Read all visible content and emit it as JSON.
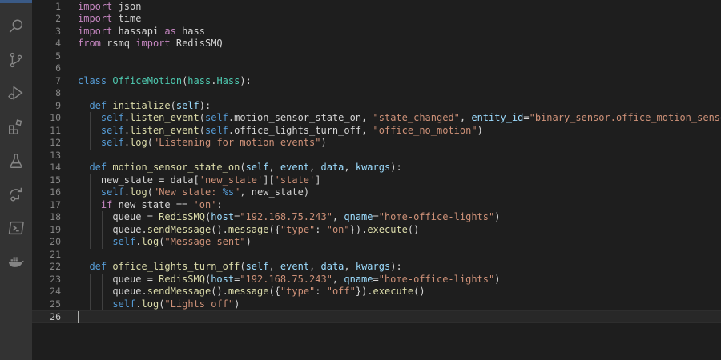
{
  "activity_bar": {
    "items": [
      {
        "name": "explorer-icon"
      },
      {
        "name": "search-icon"
      },
      {
        "name": "source-control-icon"
      },
      {
        "name": "run-debug-icon"
      },
      {
        "name": "extensions-icon"
      },
      {
        "name": "testing-icon"
      },
      {
        "name": "remote-explorer-icon"
      },
      {
        "name": "terminal-icon"
      },
      {
        "name": "docker-icon"
      }
    ]
  },
  "editor": {
    "language": "python",
    "cursor_line": 26,
    "lines": [
      {
        "n": "1",
        "indent": 0,
        "tokens": [
          [
            "import",
            "ctl"
          ],
          [
            " json",
            "pl"
          ]
        ]
      },
      {
        "n": "2",
        "indent": 0,
        "tokens": [
          [
            "import",
            "ctl"
          ],
          [
            " time",
            "pl"
          ]
        ]
      },
      {
        "n": "3",
        "indent": 0,
        "tokens": [
          [
            "import",
            "ctl"
          ],
          [
            " hassapi ",
            "pl"
          ],
          [
            "as",
            "ctl"
          ],
          [
            " hass",
            "pl"
          ]
        ]
      },
      {
        "n": "4",
        "indent": 0,
        "tokens": [
          [
            "from",
            "ctl"
          ],
          [
            " rsmq ",
            "pl"
          ],
          [
            "import",
            "ctl"
          ],
          [
            " RedisSMQ",
            "pl"
          ]
        ]
      },
      {
        "n": "5",
        "indent": 0,
        "tokens": []
      },
      {
        "n": "6",
        "indent": 0,
        "tokens": []
      },
      {
        "n": "7",
        "indent": 0,
        "tokens": [
          [
            "class",
            "kw"
          ],
          [
            " ",
            "pl"
          ],
          [
            "OfficeMotion",
            "cls"
          ],
          [
            "(",
            "pl"
          ],
          [
            "hass",
            "cls"
          ],
          [
            ".",
            "pl"
          ],
          [
            "Hass",
            "cls"
          ],
          [
            "):",
            "pl"
          ]
        ]
      },
      {
        "n": "8",
        "indent": 0,
        "tokens": []
      },
      {
        "n": "9",
        "indent": 1,
        "tokens": [
          [
            "  ",
            "pl"
          ],
          [
            "def",
            "kw"
          ],
          [
            " ",
            "pl"
          ],
          [
            "initialize",
            "fn"
          ],
          [
            "(",
            "pl"
          ],
          [
            "self",
            "prm"
          ],
          [
            "):",
            "pl"
          ]
        ]
      },
      {
        "n": "10",
        "indent": 2,
        "tokens": [
          [
            "    ",
            "pl"
          ],
          [
            "self",
            "slf"
          ],
          [
            ".",
            "pl"
          ],
          [
            "listen_event",
            "fn"
          ],
          [
            "(",
            "pl"
          ],
          [
            "self",
            "slf"
          ],
          [
            ".motion_sensor_state_on, ",
            "pl"
          ],
          [
            "\"state_changed\"",
            "str"
          ],
          [
            ", ",
            "pl"
          ],
          [
            "entity_id",
            "prm"
          ],
          [
            "=",
            "pl"
          ],
          [
            "\"binary_sensor.office_motion_sensor\"",
            "str"
          ],
          [
            ")",
            "pl"
          ]
        ]
      },
      {
        "n": "11",
        "indent": 2,
        "tokens": [
          [
            "    ",
            "pl"
          ],
          [
            "self",
            "slf"
          ],
          [
            ".",
            "pl"
          ],
          [
            "listen_event",
            "fn"
          ],
          [
            "(",
            "pl"
          ],
          [
            "self",
            "slf"
          ],
          [
            ".office_lights_turn_off, ",
            "pl"
          ],
          [
            "\"office_no_motion\"",
            "str"
          ],
          [
            ")",
            "pl"
          ]
        ]
      },
      {
        "n": "12",
        "indent": 2,
        "tokens": [
          [
            "    ",
            "pl"
          ],
          [
            "self",
            "slf"
          ],
          [
            ".",
            "pl"
          ],
          [
            "log",
            "fn"
          ],
          [
            "(",
            "pl"
          ],
          [
            "\"Listening for motion events\"",
            "str"
          ],
          [
            ")",
            "pl"
          ]
        ]
      },
      {
        "n": "13",
        "indent": 1,
        "tokens": []
      },
      {
        "n": "14",
        "indent": 1,
        "tokens": [
          [
            "  ",
            "pl"
          ],
          [
            "def",
            "kw"
          ],
          [
            " ",
            "pl"
          ],
          [
            "motion_sensor_state_on",
            "fn"
          ],
          [
            "(",
            "pl"
          ],
          [
            "self",
            "prm"
          ],
          [
            ", ",
            "pl"
          ],
          [
            "event",
            "prm"
          ],
          [
            ", ",
            "pl"
          ],
          [
            "data",
            "prm"
          ],
          [
            ", ",
            "pl"
          ],
          [
            "kwargs",
            "prm"
          ],
          [
            "):",
            "pl"
          ]
        ]
      },
      {
        "n": "15",
        "indent": 2,
        "tokens": [
          [
            "    ",
            "pl"
          ],
          [
            "new_state = data[",
            "pl"
          ],
          [
            "'new_state'",
            "str"
          ],
          [
            "][",
            "pl"
          ],
          [
            "'state'",
            "str"
          ],
          [
            "]",
            "pl"
          ]
        ]
      },
      {
        "n": "16",
        "indent": 2,
        "tokens": [
          [
            "    ",
            "pl"
          ],
          [
            "self",
            "slf"
          ],
          [
            ".",
            "pl"
          ],
          [
            "log",
            "fn"
          ],
          [
            "(",
            "pl"
          ],
          [
            "\"New state: ",
            "str"
          ],
          [
            "%s",
            "esc"
          ],
          [
            "\"",
            "str"
          ],
          [
            ", new_state)",
            "pl"
          ]
        ]
      },
      {
        "n": "17",
        "indent": 2,
        "tokens": [
          [
            "    ",
            "pl"
          ],
          [
            "if",
            "ctl"
          ],
          [
            " new_state == ",
            "pl"
          ],
          [
            "'on'",
            "str"
          ],
          [
            ":",
            "pl"
          ]
        ]
      },
      {
        "n": "18",
        "indent": 3,
        "tokens": [
          [
            "      ",
            "pl"
          ],
          [
            "queue = ",
            "pl"
          ],
          [
            "RedisSMQ",
            "fn"
          ],
          [
            "(",
            "pl"
          ],
          [
            "host",
            "prm"
          ],
          [
            "=",
            "pl"
          ],
          [
            "\"192.168.75.243\"",
            "str"
          ],
          [
            ", ",
            "pl"
          ],
          [
            "qname",
            "prm"
          ],
          [
            "=",
            "pl"
          ],
          [
            "\"home-office-lights\"",
            "str"
          ],
          [
            ")",
            "pl"
          ]
        ]
      },
      {
        "n": "19",
        "indent": 3,
        "tokens": [
          [
            "      ",
            "pl"
          ],
          [
            "queue.",
            "pl"
          ],
          [
            "sendMessage",
            "fn"
          ],
          [
            "().",
            "pl"
          ],
          [
            "message",
            "fn"
          ],
          [
            "({",
            "pl"
          ],
          [
            "\"type\"",
            "str"
          ],
          [
            ": ",
            "pl"
          ],
          [
            "\"on\"",
            "str"
          ],
          [
            "}).",
            "pl"
          ],
          [
            "execute",
            "fn"
          ],
          [
            "()",
            "pl"
          ]
        ]
      },
      {
        "n": "20",
        "indent": 3,
        "tokens": [
          [
            "      ",
            "pl"
          ],
          [
            "self",
            "slf"
          ],
          [
            ".",
            "pl"
          ],
          [
            "log",
            "fn"
          ],
          [
            "(",
            "pl"
          ],
          [
            "\"Message sent\"",
            "str"
          ],
          [
            ")",
            "pl"
          ]
        ]
      },
      {
        "n": "21",
        "indent": 1,
        "tokens": []
      },
      {
        "n": "22",
        "indent": 1,
        "tokens": [
          [
            "  ",
            "pl"
          ],
          [
            "def",
            "kw"
          ],
          [
            " ",
            "pl"
          ],
          [
            "office_lights_turn_off",
            "fn"
          ],
          [
            "(",
            "pl"
          ],
          [
            "self",
            "prm"
          ],
          [
            ", ",
            "pl"
          ],
          [
            "event",
            "prm"
          ],
          [
            ", ",
            "pl"
          ],
          [
            "data",
            "prm"
          ],
          [
            ", ",
            "pl"
          ],
          [
            "kwargs",
            "prm"
          ],
          [
            "):",
            "pl"
          ]
        ]
      },
      {
        "n": "23",
        "indent": 3,
        "tokens": [
          [
            "      ",
            "pl"
          ],
          [
            "queue = ",
            "pl"
          ],
          [
            "RedisSMQ",
            "fn"
          ],
          [
            "(",
            "pl"
          ],
          [
            "host",
            "prm"
          ],
          [
            "=",
            "pl"
          ],
          [
            "\"192.168.75.243\"",
            "str"
          ],
          [
            ", ",
            "pl"
          ],
          [
            "qname",
            "prm"
          ],
          [
            "=",
            "pl"
          ],
          [
            "\"home-office-lights\"",
            "str"
          ],
          [
            ")",
            "pl"
          ]
        ]
      },
      {
        "n": "24",
        "indent": 3,
        "tokens": [
          [
            "      ",
            "pl"
          ],
          [
            "queue.",
            "pl"
          ],
          [
            "sendMessage",
            "fn"
          ],
          [
            "().",
            "pl"
          ],
          [
            "message",
            "fn"
          ],
          [
            "({",
            "pl"
          ],
          [
            "\"type\"",
            "str"
          ],
          [
            ": ",
            "pl"
          ],
          [
            "\"off\"",
            "str"
          ],
          [
            "}).",
            "pl"
          ],
          [
            "execute",
            "fn"
          ],
          [
            "()",
            "pl"
          ]
        ]
      },
      {
        "n": "25",
        "indent": 3,
        "tokens": [
          [
            "      ",
            "pl"
          ],
          [
            "self",
            "slf"
          ],
          [
            ".",
            "pl"
          ],
          [
            "log",
            "fn"
          ],
          [
            "(",
            "pl"
          ],
          [
            "\"Lights off\"",
            "str"
          ],
          [
            ")",
            "pl"
          ]
        ]
      },
      {
        "n": "26",
        "indent": 0,
        "tokens": []
      }
    ]
  }
}
